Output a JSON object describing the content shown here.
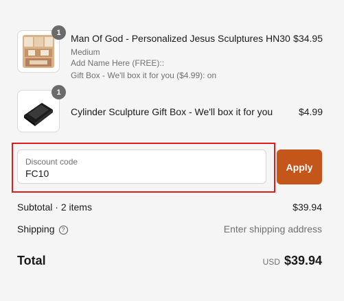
{
  "items": [
    {
      "quantity": "1",
      "title": "Man Of God - Personalized Jesus Sculptures HN30",
      "variant": "Medium",
      "options": [
        "Add Name Here (FREE)::",
        "Gift Box - We'll box it for you ($4.99): on"
      ],
      "price": "$34.95",
      "image": "sculpture-thumbnail"
    },
    {
      "quantity": "1",
      "title": "Cylinder Sculpture Gift Box - We'll box it for you",
      "price": "$4.99",
      "image": "gift-box-thumbnail"
    }
  ],
  "discount": {
    "label": "Discount code",
    "value": "FC10",
    "apply_label": "Apply",
    "highlight_color": "#e01b1b",
    "button_color": "#c4561a"
  },
  "summary": {
    "subtotal_label": "Subtotal · 2 items",
    "subtotal_value": "$39.94",
    "shipping_label": "Shipping",
    "shipping_value": "Enter shipping address",
    "total_label": "Total",
    "currency": "USD",
    "total_value": "$39.94"
  }
}
